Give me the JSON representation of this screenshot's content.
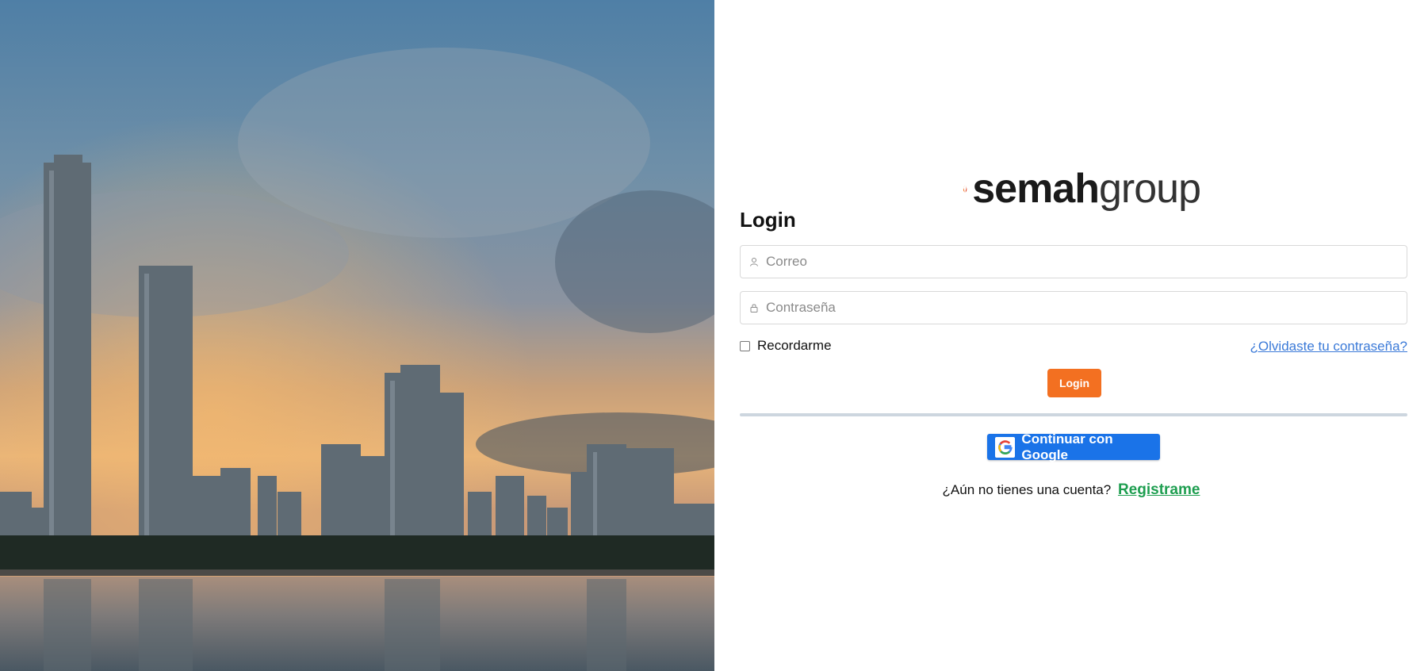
{
  "brand": {
    "logo_bold": "semah",
    "logo_light": "group",
    "accent_color": "#f37021",
    "link_green": "#1e9e50"
  },
  "login": {
    "title": "Login",
    "email_placeholder": "Correo",
    "email_icon": "user-icon",
    "password_placeholder": "Contraseña",
    "password_icon": "lock-icon",
    "remember_label": "Recordarme",
    "remember_checked": false,
    "forgot_link": "¿Olvidaste tu contraseña?",
    "submit_label": "Login",
    "google_label": "Continuar con Google",
    "google_icon": "google-icon",
    "signup_prompt": "¿Aún no tienes una cuenta?",
    "signup_link": "Registrame"
  },
  "hero": {
    "image": "panama-city-skyline-sunset"
  }
}
